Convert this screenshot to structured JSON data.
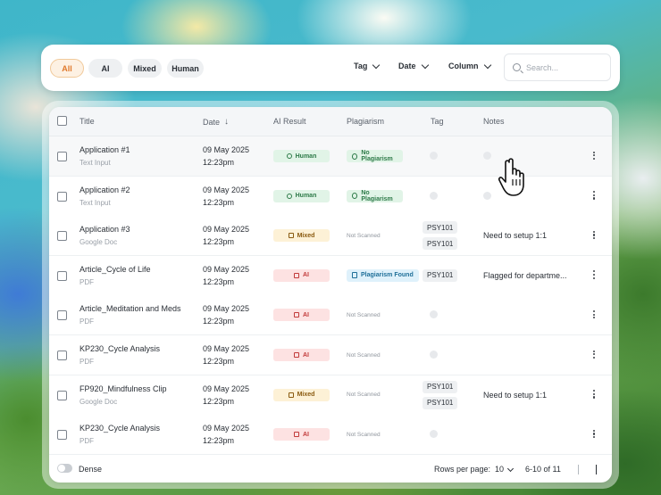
{
  "filters": {
    "pills": [
      {
        "label": "All",
        "active": true
      },
      {
        "label": "AI",
        "active": false
      },
      {
        "label": "Mixed",
        "active": false
      },
      {
        "label": "Human",
        "active": false
      }
    ],
    "dropdowns": [
      "Tag",
      "Date",
      "Column"
    ],
    "search_placeholder": "Search..."
  },
  "table": {
    "headers": {
      "title": "Title",
      "date": "Date",
      "ai_result": "AI Result",
      "plagiarism": "Plagiarism",
      "tag": "Tag",
      "notes": "Notes"
    },
    "rows": [
      {
        "title": "Application #1",
        "source": "Text Input",
        "date": "09 May 2025",
        "time": "12:23pm",
        "ai": "Human",
        "plag": "No Plagiarism",
        "tags": [],
        "note": ""
      },
      {
        "title": "Application #2",
        "source": "Text Input",
        "date": "09 May 2025",
        "time": "12:23pm",
        "ai": "Human",
        "plag": "No Plagiarism",
        "tags": [],
        "note": ""
      },
      {
        "title": "Application #3",
        "source": "Google Doc",
        "date": "09 May 2025",
        "time": "12:23pm",
        "ai": "Mixed",
        "plag": "Not Scanned",
        "tags": [
          "PSY101",
          "PSY101"
        ],
        "note": "Need to setup 1:1"
      },
      {
        "title": "Article_Cycle of Life",
        "source": "PDF",
        "date": "09 May 2025",
        "time": "12:23pm",
        "ai": "AI",
        "plag": "Plagiarism Found",
        "tags": [
          "PSY101"
        ],
        "note": "Flagged for departme..."
      },
      {
        "title": "Article_Meditation and Meds",
        "source": "PDF",
        "date": "09 May 2025",
        "time": "12:23pm",
        "ai": "AI",
        "plag": "Not Scanned",
        "tags": [],
        "note": ""
      },
      {
        "title": "KP230_Cycle Analysis",
        "source": "PDF",
        "date": "09 May 2025",
        "time": "12:23pm",
        "ai": "AI",
        "plag": "Not Scanned",
        "tags": [],
        "note": ""
      },
      {
        "title": "FP920_Mindfulness Clip",
        "source": "Google Doc",
        "date": "09 May 2025",
        "time": "12:23pm",
        "ai": "Mixed",
        "plag": "Not Scanned",
        "tags": [
          "PSY101",
          "PSY101"
        ],
        "note": "Need to setup 1:1"
      },
      {
        "title": "KP230_Cycle Analysis",
        "source": "PDF",
        "date": "09 May 2025",
        "time": "12:23pm",
        "ai": "AI",
        "plag": "Not Scanned",
        "tags": [],
        "note": ""
      }
    ]
  },
  "footer": {
    "dense_label": "Dense",
    "rows_per_page_label": "Rows per page:",
    "rows_per_page_value": "10",
    "range": "6-10 of 11"
  },
  "colors": {
    "accent": "#e0792b",
    "human": "#2d7a48",
    "mixed": "#8a5a10",
    "ai": "#c23a3a",
    "plag_found": "#1f6f99"
  }
}
